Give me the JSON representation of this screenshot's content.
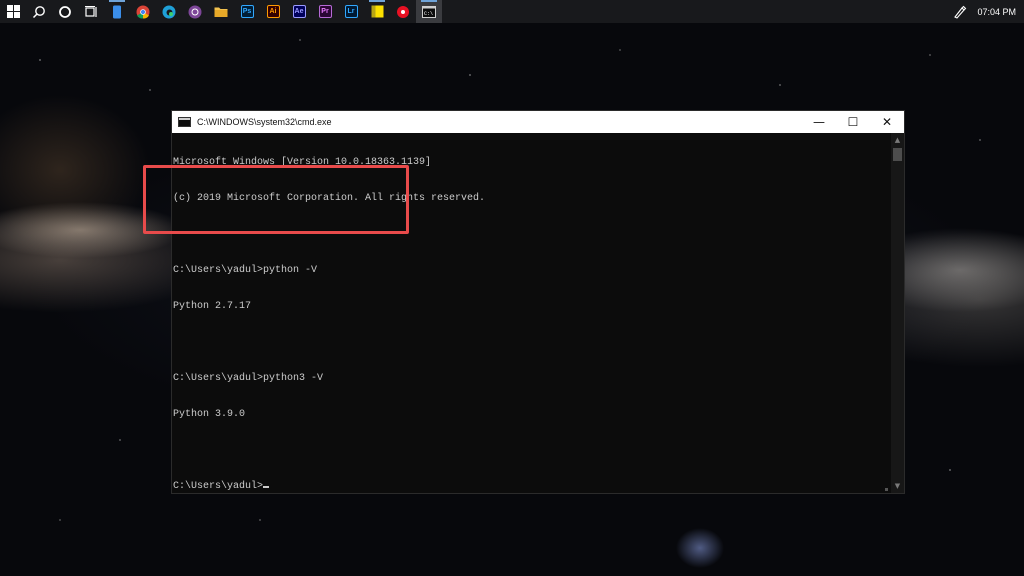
{
  "taskbar": {
    "apps": [
      {
        "name": "start-button",
        "glyph": ""
      },
      {
        "name": "search-icon",
        "glyph": "⌕"
      },
      {
        "name": "cortana-icon",
        "glyph": ""
      },
      {
        "name": "task-view-icon",
        "glyph": ""
      },
      {
        "name": "phone-icon",
        "glyph": ""
      },
      {
        "name": "chrome-icon",
        "glyph": ""
      },
      {
        "name": "edge-icon",
        "glyph": ""
      },
      {
        "name": "tor-browser-icon",
        "glyph": ""
      },
      {
        "name": "file-explorer-icon",
        "glyph": ""
      },
      {
        "name": "photoshop-icon",
        "glyph": "Ps"
      },
      {
        "name": "illustrator-icon",
        "glyph": "Ai"
      },
      {
        "name": "after-effects-icon",
        "glyph": "Ae"
      },
      {
        "name": "premiere-pro-icon",
        "glyph": "Pr"
      },
      {
        "name": "lightroom-icon",
        "glyph": "Lr"
      },
      {
        "name": "sticky-notes-icon",
        "glyph": ""
      },
      {
        "name": "app-red-icon",
        "glyph": ""
      },
      {
        "name": "command-prompt-icon",
        "glyph": "C:\\"
      }
    ],
    "clock": "07:04 PM",
    "colors": {
      "taskbar_bg": "#18191c",
      "photoshop": "#31a8ff",
      "illustrator": "#ff9a00",
      "after_effects": "#9999ff",
      "premiere": "#9999ff",
      "lightroom": "#31a8ff"
    }
  },
  "cmd_window": {
    "title": "C:\\WINDOWS\\system32\\cmd.exe",
    "controls": {
      "minimize": "—",
      "maximize": "☐",
      "close": "✕"
    },
    "lines": [
      "Microsoft Windows [Version 10.0.18363.1139]",
      "(c) 2019 Microsoft Corporation. All rights reserved.",
      "",
      "C:\\Users\\yadul>python -V",
      "Python 2.7.17",
      "",
      "C:\\Users\\yadul>python3 -V",
      "Python 3.9.0",
      "",
      "C:\\Users\\yadul>"
    ],
    "scroll_up": "▲",
    "scroll_down": "▼",
    "colors": {
      "text": "#cccccc",
      "background": "#0c0c0c",
      "highlight": "#e84b4b"
    }
  }
}
